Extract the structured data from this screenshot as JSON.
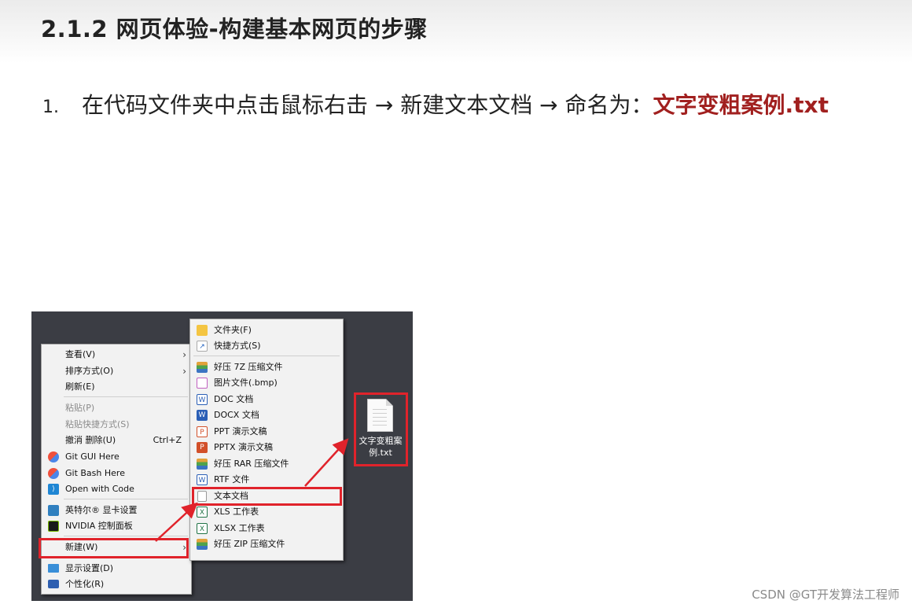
{
  "slide": {
    "title": "2.1.2 网页体验-构建基本网页的步骤",
    "step": {
      "number": "1.",
      "text": "在代码文件夹中点击鼠标右击 → 新建文本文档 → 命名为：",
      "highlight": "文字变粗案例.txt",
      "highlight_color": "#a1201f"
    }
  },
  "context_menu": {
    "items": [
      {
        "label": "查看(V)",
        "has_submenu": true
      },
      {
        "label": "排序方式(O)",
        "has_submenu": true
      },
      {
        "label": "刷新(E)"
      },
      {
        "label": "粘贴(P)",
        "disabled": true
      },
      {
        "label": "粘贴快捷方式(S)",
        "disabled": true
      },
      {
        "label": "撤消 删除(U)",
        "shortcut": "Ctrl+Z"
      },
      {
        "label": "Git GUI Here",
        "icon": "git-icon"
      },
      {
        "label": "Git Bash Here",
        "icon": "git-icon"
      },
      {
        "label": "Open with Code",
        "icon": "vscode-icon"
      },
      {
        "label": "英特尔® 显卡设置",
        "icon": "intel-graphics-icon"
      },
      {
        "label": "NVIDIA 控制面板",
        "icon": "nvidia-icon"
      },
      {
        "label": "新建(W)",
        "has_submenu": true,
        "highlighted": true
      },
      {
        "label": "显示设置(D)",
        "icon": "display-icon"
      },
      {
        "label": "个性化(R)",
        "icon": "personalize-icon"
      }
    ]
  },
  "new_submenu": {
    "items": [
      {
        "label": "文件夹(F)",
        "icon": "folder-icon"
      },
      {
        "label": "快捷方式(S)",
        "icon": "shortcut-icon"
      },
      {
        "label": "好压 7Z 压缩文件",
        "icon": "archive-icon"
      },
      {
        "label": "图片文件(.bmp)",
        "icon": "bmp-icon"
      },
      {
        "label": "DOC 文档",
        "icon": "doc-icon"
      },
      {
        "label": "DOCX 文档",
        "icon": "docx-icon"
      },
      {
        "label": "PPT 演示文稿",
        "icon": "ppt-icon"
      },
      {
        "label": "PPTX 演示文稿",
        "icon": "pptx-icon"
      },
      {
        "label": "好压 RAR 压缩文件",
        "icon": "archive-icon"
      },
      {
        "label": "RTF 文件",
        "icon": "rtf-icon"
      },
      {
        "label": "文本文档",
        "icon": "text-document-icon",
        "highlighted": true
      },
      {
        "label": "XLS 工作表",
        "icon": "xls-icon"
      },
      {
        "label": "XLSX 工作表",
        "icon": "xlsx-icon"
      },
      {
        "label": "好压 ZIP 压缩文件",
        "icon": "archive-icon"
      }
    ]
  },
  "desktop_file": {
    "name_line1": "文字变粗案",
    "name_line2": "例.txt",
    "icon": "text-file-icon"
  },
  "annotation_color": "#e0232b",
  "watermark": "CSDN @GT开发算法工程师"
}
